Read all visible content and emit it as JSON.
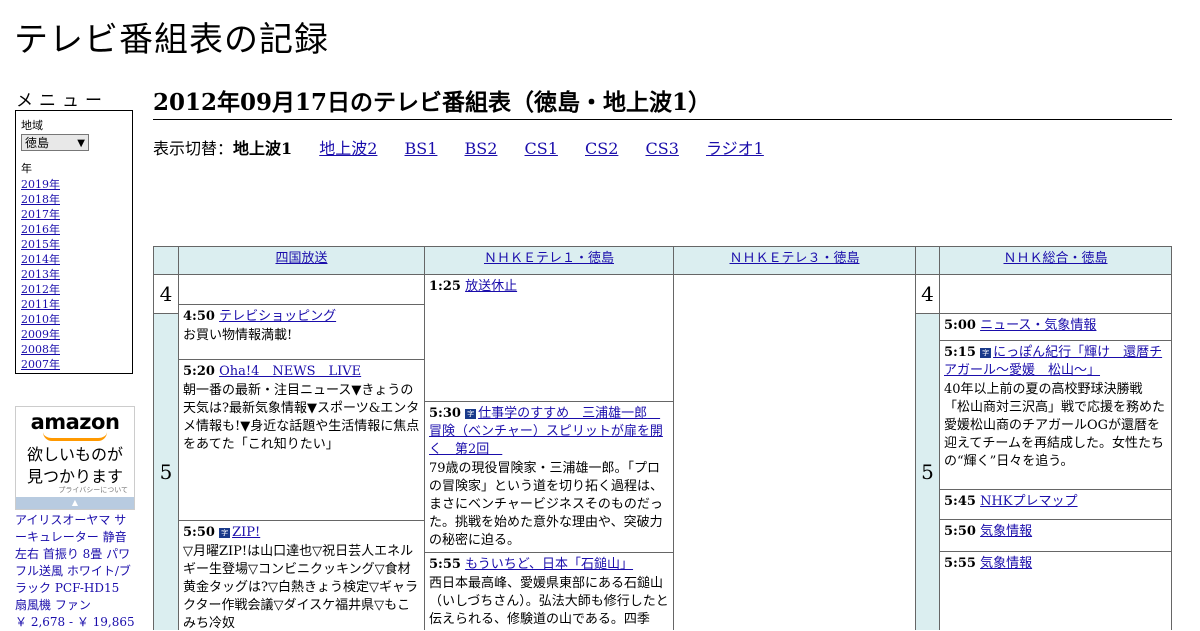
{
  "site_title": "テレビ番組表の記録",
  "menu": {
    "title": "メニュー",
    "region_label": "地域",
    "region_value": "徳島",
    "year_label": "年",
    "years": [
      "2019年",
      "2018年",
      "2017年",
      "2016年",
      "2015年",
      "2014年",
      "2013年",
      "2012年",
      "2011年",
      "2010年",
      "2009年",
      "2008年",
      "2007年"
    ]
  },
  "ad": {
    "brand": "amazon",
    "catch_line1": "欲しいものが",
    "catch_line2": "見つかります",
    "privacy": "プライバシーについて",
    "product": "アイリスオーヤマ サーキュレーター 静音 左右 首振り 8畳 パワフル送風 ホワイト/ブラック PCF-HD15 扇風機 ファン",
    "price": "￥ 2,678 - ￥ 19,865"
  },
  "page_heading": "2012年09月17日のテレビ番組表（徳島・地上波1）",
  "switcher": {
    "label": "表示切替：",
    "current": "地上波1",
    "links": [
      "地上波2",
      "BS1",
      "BS2",
      "CS1",
      "CS2",
      "CS3",
      "ラジオ1"
    ]
  },
  "channels": [
    "四国放送",
    "ＮＨＫＥテレ１・徳島",
    "ＮＨＫＥテレ３・徳島",
    "ＮＨＫ総合・徳島"
  ],
  "hours": [
    "4",
    "5",
    "4",
    "5"
  ],
  "programs": {
    "shikoku": [
      {
        "time": "4:50",
        "title": "テレビショッピング",
        "desc": "お買い物情報満載!"
      },
      {
        "time": "5:20",
        "title": "Oha!4　NEWS　LIVE",
        "desc": "朝一番の最新・注目ニュース▼きょうの天気は?最新気象情報▼スポーツ&エンタメ情報も!▼身近な話題や生活情報に焦点をあてた「これ知りたい」"
      },
      {
        "time": "5:50",
        "badge": "字",
        "title": "ZIP!",
        "desc": "▽月曜ZIP!は山口達也▽祝日芸人エネルギー生登場▽コンビニクッキング▽食材黄金タッグは?▽白熱きょう検定▽ギャラクター作戦会議▽ダイスケ福井県▽もこみち冷奴"
      }
    ],
    "etele1": [
      {
        "time": "1:25",
        "title": "放送休止",
        "desc": ""
      },
      {
        "time": "5:30",
        "badge": "字",
        "title": "仕事学のすすめ　三浦雄一郎　冒険（ベンチャー）スピリットが扉を開く　第2回　",
        "desc": "79歳の現役冒険家・三浦雄一郎。「プロの冒険家」という道を切り拓く過程は、まさにベンチャービジネスそのものだった。挑戦を始めた意外な理由や、突破力の秘密に迫る。"
      },
      {
        "time": "5:55",
        "title": "もういちど、日本「石鎚山」",
        "desc": "西日本最高峰、愛媛県東部にある石鎚山（いしづちさん）。弘法大師も修行したと伝えられる、修験道の山である。四季"
      }
    ],
    "sougou": [
      {
        "time": "5:00",
        "title": "ニュース・気象情報",
        "desc": ""
      },
      {
        "time": "5:15",
        "badge": "字",
        "title": "にっぽん紀行「輝け　還暦チアガール～愛媛　松山～」",
        "desc": "40年以上前の夏の高校野球決勝戦「松山商対三沢高」戦で応援を務めた愛媛松山商のチアガールOGが還暦を迎えてチームを再結成した。女性たちの“輝く”日々を追う。"
      },
      {
        "time": "5:45",
        "title": "NHKプレマップ",
        "desc": ""
      },
      {
        "time": "5:50",
        "title": "気象情報",
        "desc": ""
      },
      {
        "time": "5:55",
        "title": "気象情報",
        "desc": ""
      }
    ]
  },
  "colors": {
    "header_bg": "#dbeef0",
    "link": "#1a0dab",
    "badge": "#1a3a8a",
    "ad_accent": "#ff9900"
  }
}
